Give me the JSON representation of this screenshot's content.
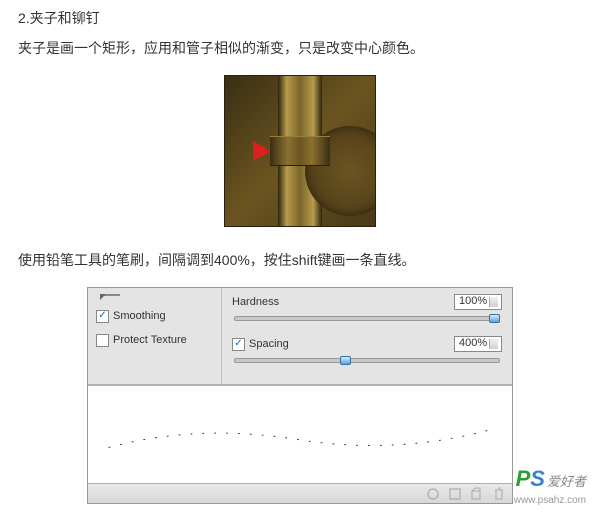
{
  "section": {
    "number_title": "2.夹子和铆钉",
    "desc1": "夹子是画一个矩形，应用和管子相似的渐变，只是改变中心颜色。",
    "desc2": "使用铅笔工具的笔刷，间隔调到400%，按住shift键画一条直线。"
  },
  "panel": {
    "smoothing": {
      "label": "Smoothing",
      "checked": true
    },
    "protect_texture": {
      "label": "Protect Texture",
      "checked": false
    },
    "hardness": {
      "label": "Hardness",
      "value": "100%",
      "pos": 100
    },
    "spacing": {
      "label": "Spacing",
      "checked": true,
      "value": "400%",
      "pos": 40
    }
  },
  "watermark": {
    "p": "P",
    "s": "S",
    "cn": "爱好者",
    "url": "www.psahz.com"
  }
}
